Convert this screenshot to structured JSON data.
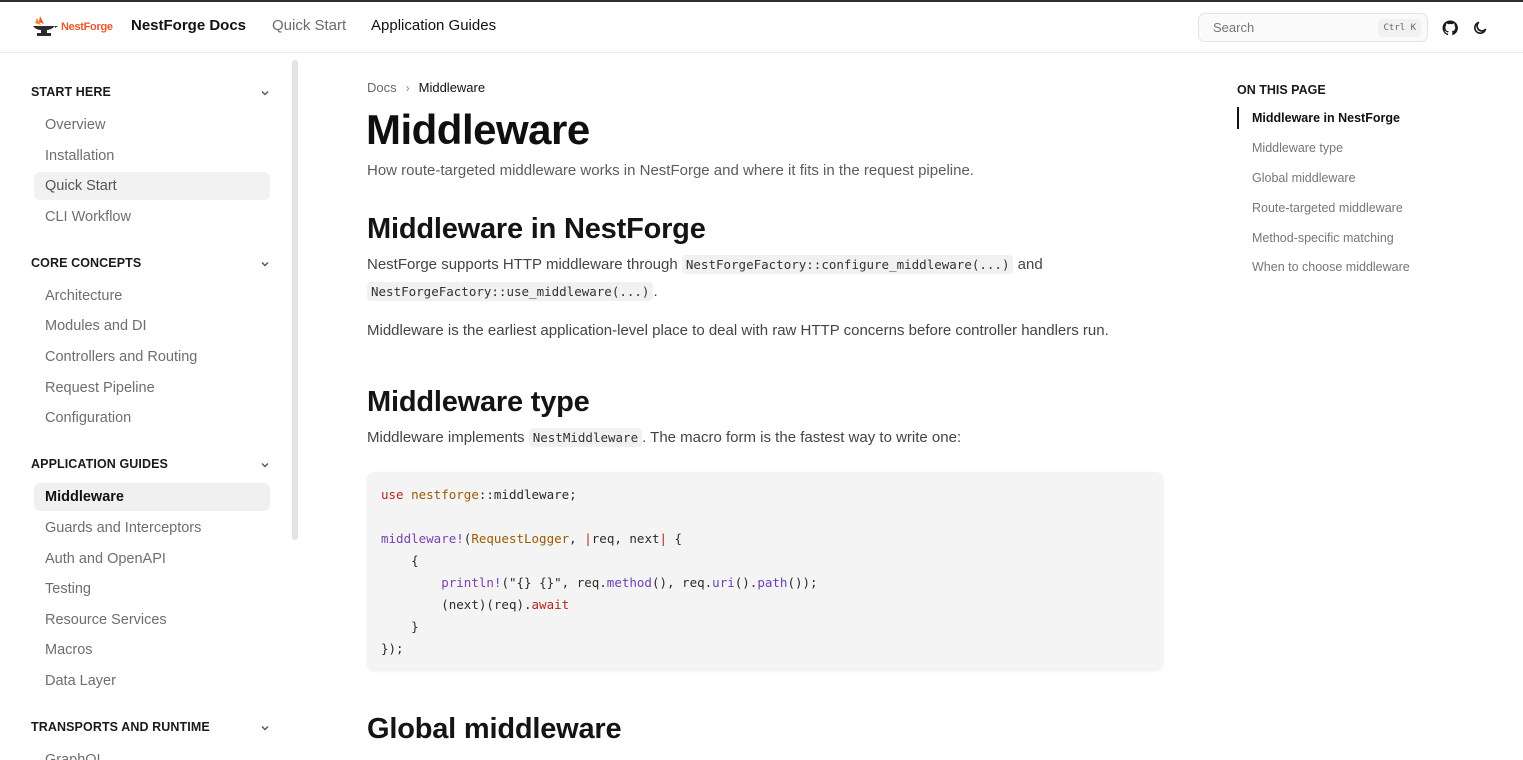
{
  "header": {
    "logo_text": "NestForge",
    "brand": "NestForge Docs",
    "nav": [
      "Quick Start",
      "Application Guides"
    ],
    "search_placeholder": "Search",
    "search_shortcut": "Ctrl K",
    "accent": "#e8582a"
  },
  "sidebar": {
    "sections": [
      {
        "title": "START HERE",
        "items": [
          "Overview",
          "Installation",
          "Quick Start",
          "CLI Workflow"
        ]
      },
      {
        "title": "CORE CONCEPTS",
        "items": [
          "Architecture",
          "Modules and DI",
          "Controllers and Routing",
          "Request Pipeline",
          "Configuration"
        ]
      },
      {
        "title": "APPLICATION GUIDES",
        "items": [
          "Middleware",
          "Guards and Interceptors",
          "Auth and OpenAPI",
          "Testing",
          "Resource Services",
          "Macros",
          "Data Layer"
        ]
      },
      {
        "title": "TRANSPORTS AND RUNTIME",
        "items": [
          "GraphQL"
        ]
      }
    ],
    "active_item": "Middleware"
  },
  "main": {
    "breadcrumb": [
      "Docs",
      "Middleware"
    ],
    "title": "Middleware",
    "lead": "How route-targeted middleware works in NestForge and where it fits in the request pipeline.",
    "section1": {
      "heading": "Middleware in NestForge",
      "p1_a": "NestForge supports HTTP middleware through ",
      "p1_code1": "NestForgeFactory::configure_middleware(...)",
      "p1_b": " and",
      "p1_code2": "NestForgeFactory::use_middleware(...)",
      "p1_c": ".",
      "p2": "Middleware is the earliest application-level place to deal with raw HTTP concerns before controller handlers run."
    },
    "section2": {
      "heading": "Middleware type",
      "p_a": "Middleware implements ",
      "p_code": "NestMiddleware",
      "p_b": ". The macro form is the fastest way to write one:"
    },
    "code": {
      "l1_kw": "use",
      "l1_path": "nestforge",
      "l1_rest": "::middleware;",
      "l3_mac": "middleware!",
      "l3_a": "(",
      "l3_ty": "RequestLogger",
      "l3_b": ", ",
      "l3_pipe1": "|",
      "l3_c": "req, next",
      "l3_pipe2": "|",
      "l3_d": " {",
      "l4": "    {",
      "l5_ind": "        ",
      "l5_mac": "println!",
      "l5_a": "(\"{} {}\", req.",
      "l5_f1": "method",
      "l5_b": "(), req.",
      "l5_f2": "uri",
      "l5_c": "().",
      "l5_f3": "path",
      "l5_d": "());",
      "l6_ind": "        ",
      "l6_a": "(next)(req).",
      "l6_kw": "await",
      "l7": "    }",
      "l8": "});"
    },
    "section3": {
      "heading": "Global middleware"
    }
  },
  "toc": {
    "title": "ON THIS PAGE",
    "items": [
      "Middleware in NestForge",
      "Middleware type",
      "Global middleware",
      "Route-targeted middleware",
      "Method-specific matching",
      "When to choose middleware"
    ],
    "active": "Middleware in NestForge"
  }
}
